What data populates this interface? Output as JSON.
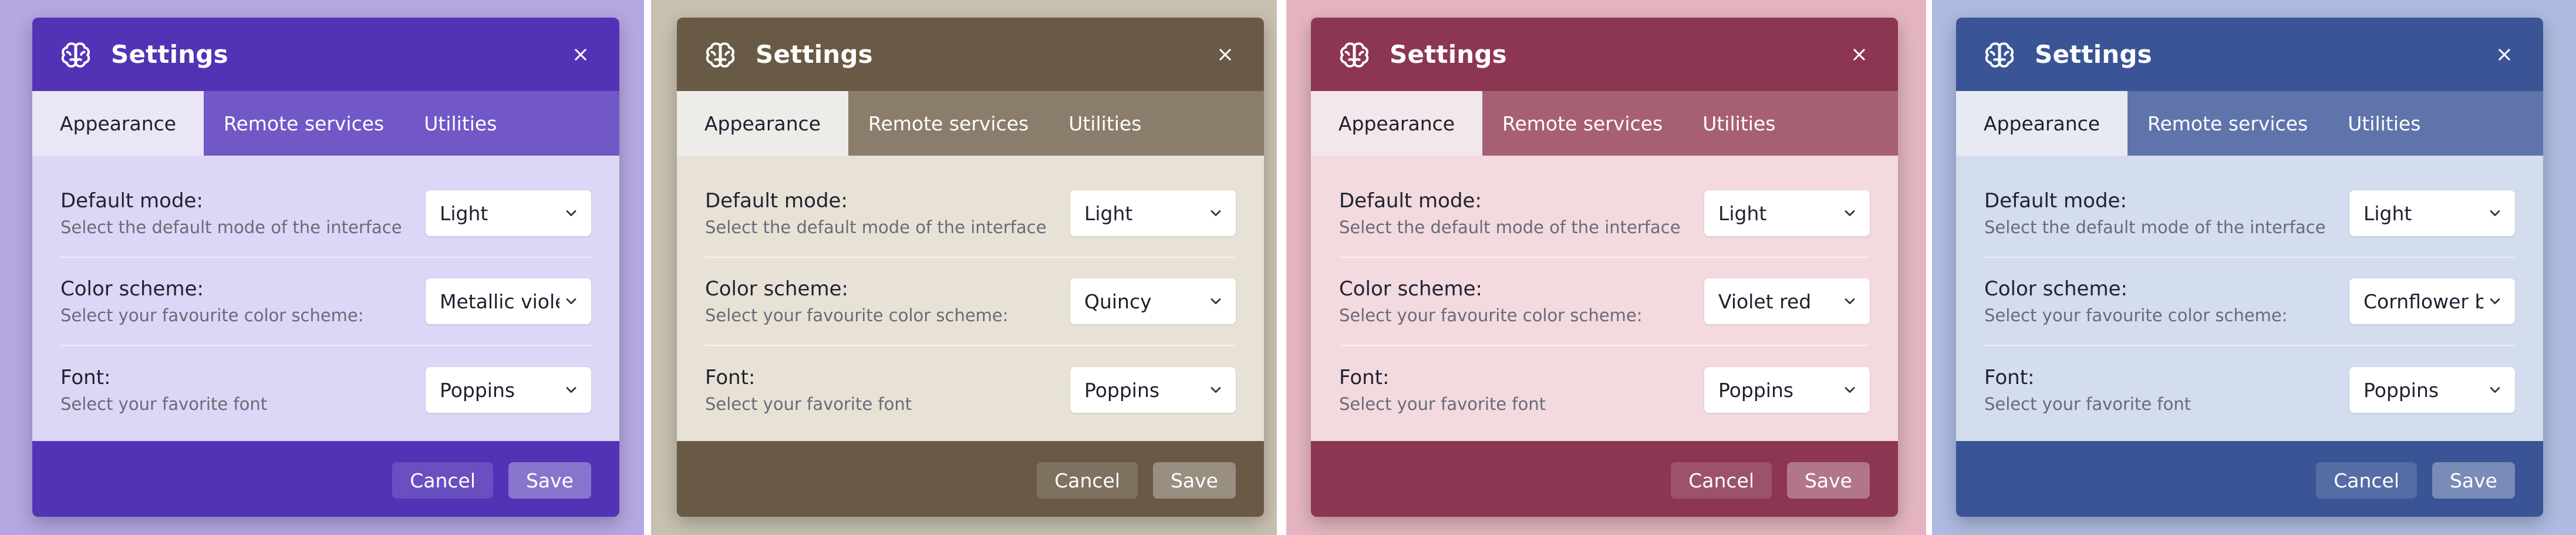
{
  "panels": [
    {
      "title": "Settings",
      "tabs": [
        "Appearance",
        "Remote services",
        "Utilities"
      ],
      "rows": [
        {
          "label": "Default mode:",
          "description": "Select the default mode of the interface",
          "value": "Light"
        },
        {
          "label": "Color scheme:",
          "description": "Select your favourite color scheme:",
          "value": "Metallic violet"
        },
        {
          "label": "Font:",
          "description": "Select your favorite font",
          "value": "Poppins"
        }
      ],
      "cancel": "Cancel",
      "save": "Save",
      "colors": {
        "background": "#b4a7e2",
        "header": "#5233b6",
        "tabs": "#7158c6",
        "body": "#ddd6f6",
        "footer": "#5233b6"
      }
    },
    {
      "title": "Settings",
      "tabs": [
        "Appearance",
        "Remote services",
        "Utilities"
      ],
      "rows": [
        {
          "label": "Default mode:",
          "description": "Select the default mode of the interface",
          "value": "Light"
        },
        {
          "label": "Color scheme:",
          "description": "Select your favourite color scheme:",
          "value": "Quincy"
        },
        {
          "label": "Font:",
          "description": "Select your favorite font",
          "value": "Poppins"
        }
      ],
      "cancel": "Cancel",
      "save": "Save",
      "colors": {
        "background": "#c8c0b1",
        "header": "#695a45",
        "tabs": "#8a7d6c",
        "body": "#e8e2d6",
        "footer": "#695a45"
      }
    },
    {
      "title": "Settings",
      "tabs": [
        "Appearance",
        "Remote services",
        "Utilities"
      ],
      "rows": [
        {
          "label": "Default mode:",
          "description": "Select the default mode of the interface",
          "value": "Light"
        },
        {
          "label": "Color scheme:",
          "description": "Select your favourite color scheme:",
          "value": "Violet red"
        },
        {
          "label": "Font:",
          "description": "Select your favorite font",
          "value": "Poppins"
        }
      ],
      "cancel": "Cancel",
      "save": "Save",
      "colors": {
        "background": "#e4b5c0",
        "header": "#8c3652",
        "tabs": "#a75f74",
        "body": "#f2dadf",
        "footer": "#8c3652"
      }
    },
    {
      "title": "Settings",
      "tabs": [
        "Appearance",
        "Remote services",
        "Utilities"
      ],
      "rows": [
        {
          "label": "Default mode:",
          "description": "Select the default mode of the interface",
          "value": "Light"
        },
        {
          "label": "Color scheme:",
          "description": "Select your favourite color scheme:",
          "value": "Cornflower blue"
        },
        {
          "label": "Font:",
          "description": "Select your favorite font",
          "value": "Poppins"
        }
      ],
      "cancel": "Cancel",
      "save": "Save",
      "colors": {
        "background": "#aebbe0",
        "header": "#3a5496",
        "tabs": "#5f74ab",
        "body": "#d3ddee",
        "footer": "#3a5496"
      }
    }
  ],
  "icons": {
    "logo": "brain-icon",
    "close": "close-icon",
    "dropdown": "chevron-down-icon"
  }
}
